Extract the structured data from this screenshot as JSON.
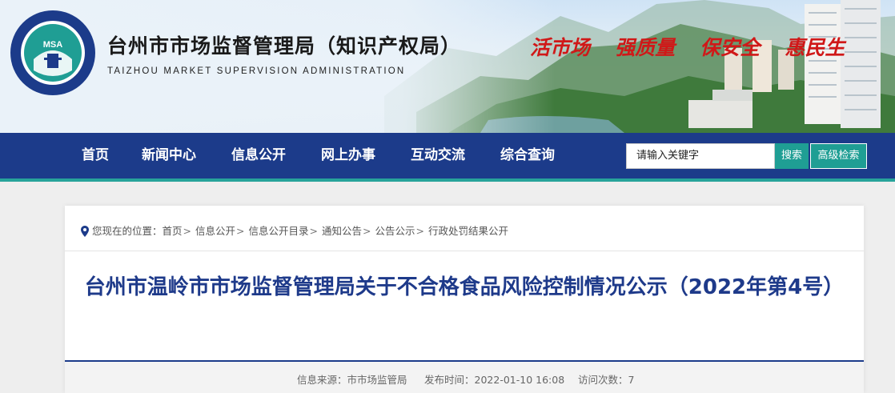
{
  "header": {
    "title": "台州市市场监督管理局（知识产权局）",
    "subtitle": "TAIZHOU MARKET SUPERVISION ADMINISTRATION",
    "logo_text": "MSA",
    "logo_ring_text": "TAIZHOU MARKET SUPERVISION ADMINISTRATION",
    "slogans": [
      "活市场",
      "强质量",
      "保安全",
      "惠民生"
    ]
  },
  "nav": {
    "items": [
      "首页",
      "新闻中心",
      "信息公开",
      "网上办事",
      "互动交流",
      "综合查询"
    ]
  },
  "search": {
    "value": "请输入关键字",
    "search_label": "搜索",
    "advanced_label": "高级检索"
  },
  "breadcrumb": {
    "prefix": "您现在的位置：",
    "items": [
      "首页",
      "信息公开",
      "信息公开目录",
      "通知公告",
      "公告公示",
      "行政处罚结果公开"
    ],
    "separator": ">"
  },
  "article": {
    "title": "台州市温岭市市场监督管理局关于不合格食品风险控制情况公示（2022年第4号）",
    "source_label": "信息来源：",
    "source": "市市场监管局",
    "time_label": "发布时间：",
    "time": "2022-01-10 16:08",
    "visits_label": "访问次数：",
    "visits": "7"
  },
  "colors": {
    "nav_bg": "#1c3b8a",
    "accent_teal": "#1f9e94",
    "title_blue": "#1e3a8a",
    "slogan_red": "#d01818"
  }
}
